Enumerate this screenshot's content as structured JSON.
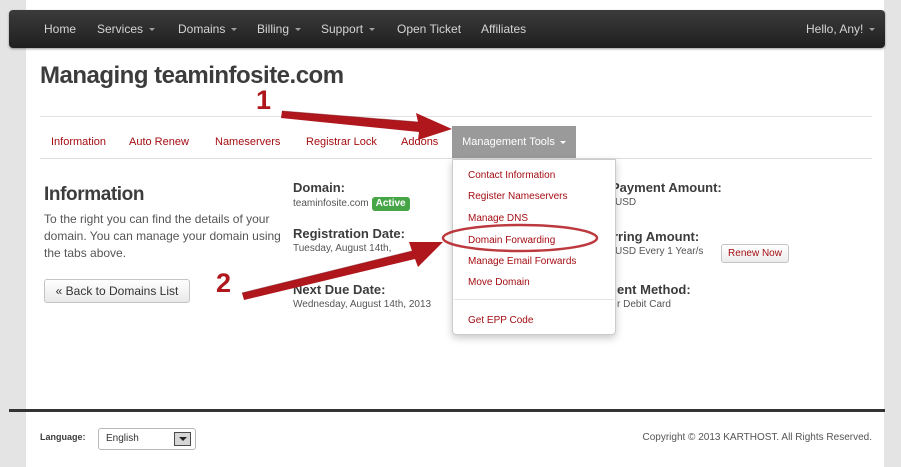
{
  "navbar": {
    "items": [
      {
        "label": "Home",
        "dropdown": false
      },
      {
        "label": "Services",
        "dropdown": true
      },
      {
        "label": "Domains",
        "dropdown": true
      },
      {
        "label": "Billing",
        "dropdown": true
      },
      {
        "label": "Support",
        "dropdown": true
      },
      {
        "label": "Open Ticket",
        "dropdown": false
      },
      {
        "label": "Affiliates",
        "dropdown": false
      }
    ],
    "user_menu": "Hello, Any!"
  },
  "page_title": "Managing teaminfosite.com",
  "tabs": {
    "items": [
      "Information",
      "Auto Renew",
      "Nameservers",
      "Registrar Lock",
      "Addons"
    ],
    "active": "Management Tools"
  },
  "management_menu": {
    "items": [
      "Contact Information",
      "Register Nameservers",
      "Manage DNS",
      "Domain Forwarding",
      "Manage Email Forwards",
      "Move Domain"
    ],
    "extra_item": "Get EPP Code"
  },
  "info": {
    "heading": "Information",
    "text": "To the right you can find the details of your domain. You can manage your domain using the tabs above.",
    "back_button": "« Back to Domains List"
  },
  "details": {
    "domain_label": "Domain:",
    "domain_value": "teaminfosite.com",
    "status": "Active",
    "registration_label": "Registration Date:",
    "registration_value": "Tuesday, August 14th,",
    "due_label": "Next Due Date:",
    "due_value": "Wednesday, August 14th, 2013",
    "first_payment_label": "Payment Amount:",
    "first_payment_value": "USD",
    "recurring_label": "rring Amount:",
    "recurring_value": "USD Every 1 Year/s",
    "renew_button": "Renew Now",
    "payment_method_label": "ent Method:",
    "payment_method_value": "r Debit Card"
  },
  "footer": {
    "language_label": "Language:",
    "language_value": "English",
    "copyright": "Copyright © 2013 KARTHOST. All Rights Reserved."
  },
  "annotations": {
    "step1": "1",
    "step2": "2",
    "color": "#b0171d"
  },
  "colors": {
    "link": "#a40d12",
    "active_tab": "#9a9a9a",
    "badge": "#46a546",
    "navbar": "#2b2b2b"
  }
}
